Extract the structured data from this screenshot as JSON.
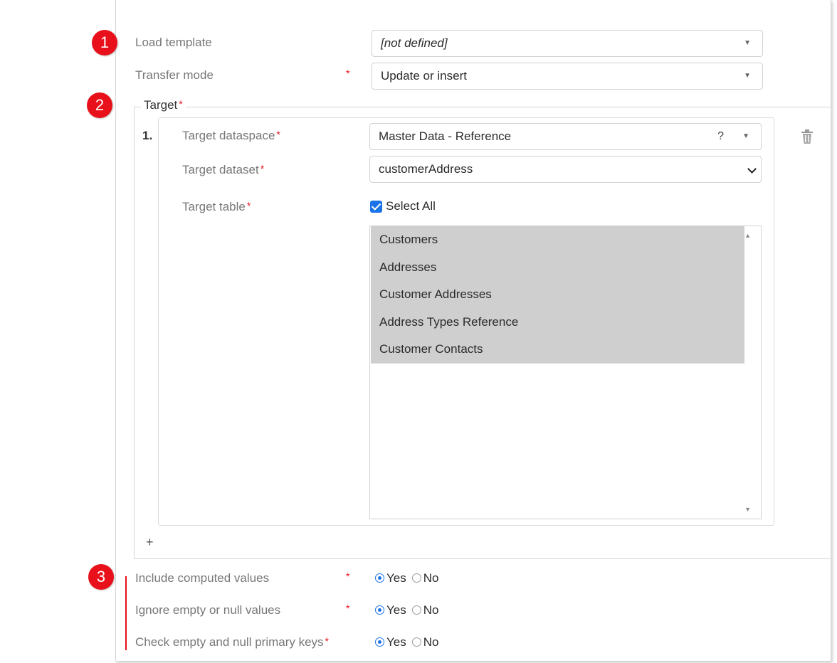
{
  "badges": [
    "1",
    "2",
    "3"
  ],
  "load_template": {
    "label": "Load template",
    "value": "[not defined]"
  },
  "transfer_mode": {
    "label": "Transfer mode",
    "value": "Update or insert"
  },
  "target": {
    "legend": "Target",
    "index": "1.",
    "dataspace": {
      "label": "Target dataspace",
      "value": "Master Data - Reference",
      "help": "?"
    },
    "dataset": {
      "label": "Target dataset",
      "value": "customerAddress"
    },
    "table": {
      "label": "Target table",
      "select_all_label": "Select All",
      "select_all_checked": true,
      "items": [
        "Customers",
        "Addresses",
        "Customer Addresses",
        "Address Types Reference",
        "Customer Contacts"
      ]
    },
    "add_label": "+"
  },
  "options": [
    {
      "label": "Include computed values",
      "yes": "Yes",
      "no": "No",
      "selected": "Yes"
    },
    {
      "label": "Ignore empty or null values",
      "yes": "Yes",
      "no": "No",
      "selected": "Yes"
    },
    {
      "label": "Check empty and null primary keys",
      "yes": "Yes",
      "no": "No",
      "selected": "Yes"
    }
  ],
  "required_marker": "*",
  "colors": {
    "accent": "#1a73e8",
    "required": "#e8101a",
    "selected_row": "#cfcfcf"
  }
}
